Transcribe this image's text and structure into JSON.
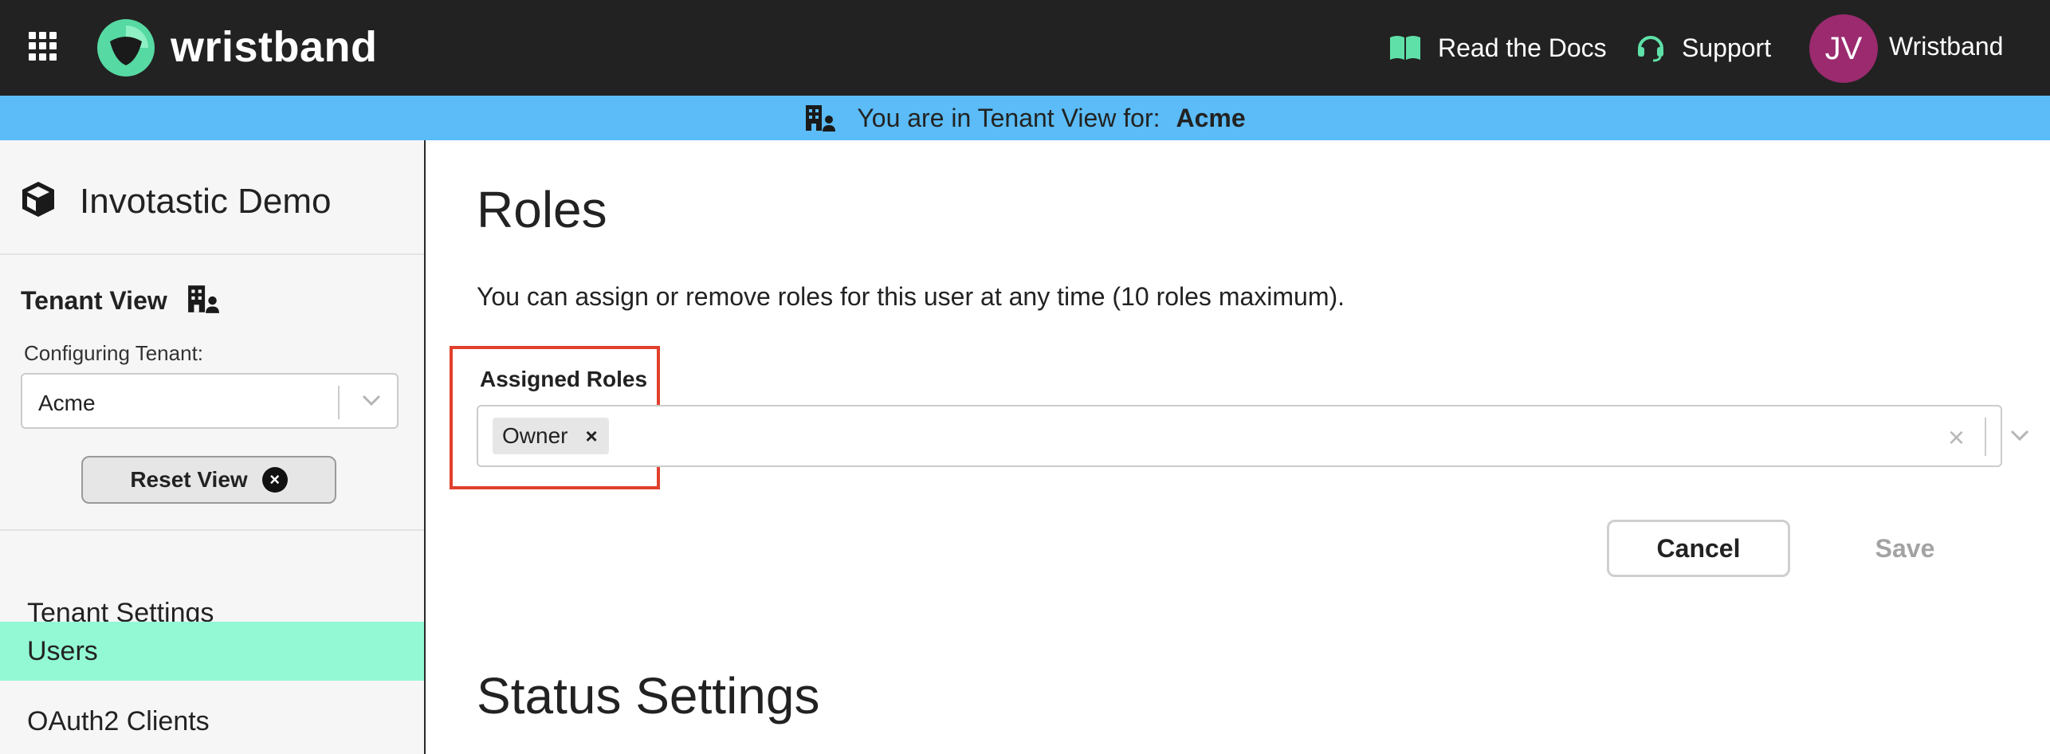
{
  "header": {
    "brand": "wristband",
    "links": {
      "docs": "Read the Docs",
      "support": "Support"
    },
    "user": {
      "initials": "JV",
      "name": "Wristband"
    },
    "icons": [
      "grid-icon",
      "wristband-logo",
      "book-icon",
      "headset-icon"
    ]
  },
  "banner": {
    "text": "You are in Tenant View for:",
    "tenant": "Acme",
    "icon": "building-user-icon"
  },
  "sidebar": {
    "app_name": "Invotastic Demo",
    "app_icon": "cube-icon",
    "tenant_view": {
      "title": "Tenant View",
      "icon": "building-user-icon",
      "configuring_label": "Configuring Tenant:",
      "selected_tenant": "Acme",
      "reset_label": "Reset View"
    },
    "items": [
      {
        "label": "Tenant Settings",
        "active": false
      },
      {
        "label": "Users",
        "active": true
      },
      {
        "label": "OAuth2 Clients",
        "active": false
      }
    ]
  },
  "main": {
    "roles": {
      "title": "Roles",
      "description": "You can assign or remove roles for this user at any time (10 roles maximum).",
      "field_label": "Assigned Roles",
      "assigned": [
        "Owner"
      ],
      "cancel_label": "Cancel",
      "save_label": "Save"
    },
    "status_title": "Status Settings"
  },
  "colors": {
    "topbar": "#222222",
    "banner": "#5bbcf7",
    "active_nav": "#92f9d4",
    "avatar": "#9b2a6f",
    "logo": "#57d9a3",
    "highlight": "#e0402c"
  }
}
